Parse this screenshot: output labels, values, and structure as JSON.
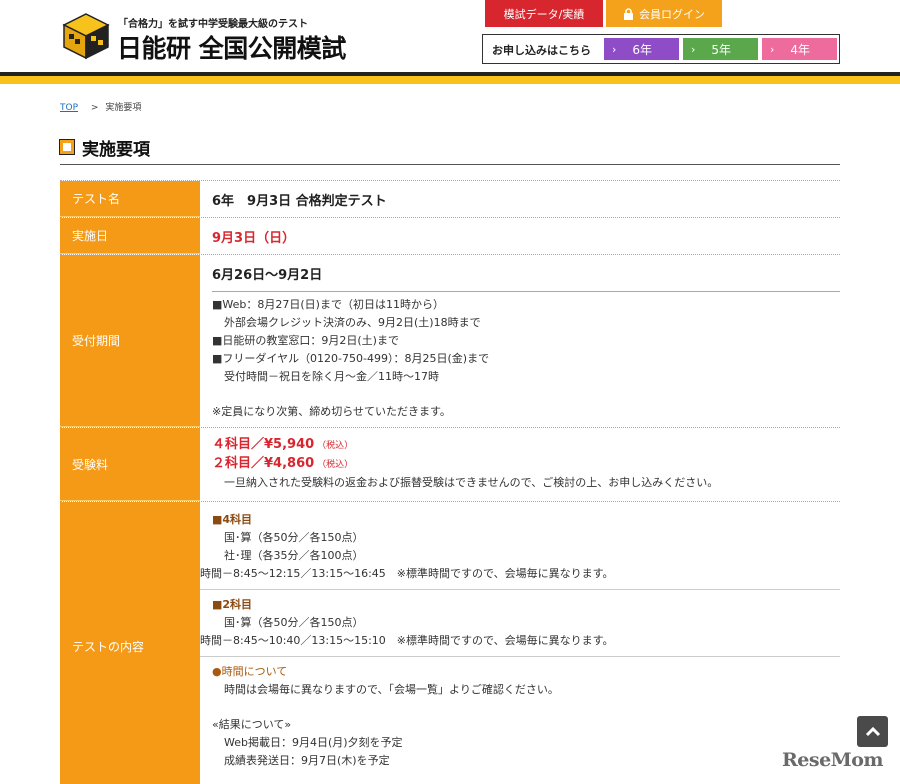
{
  "header": {
    "logo_icon": "nichinoken-zenkoku-logo-cube",
    "tagline": "「合格力」を試す中学受験最大級のテスト",
    "title": "日能研 全国公開模試",
    "data_button": "模試データ/実績",
    "login_button": "会員ログイン",
    "apply_label": "お申し込みはこちら",
    "grade_buttons": [
      {
        "label": "6年",
        "color": "#8e4cc6"
      },
      {
        "label": "5年",
        "color": "#5aa84b"
      },
      {
        "label": "4年",
        "color": "#ee6b9d"
      }
    ]
  },
  "breadcrumb": {
    "top_link": "TOP",
    "separator": ">",
    "current": "実施要項"
  },
  "page_title": "実施要項",
  "table": {
    "test_name": {
      "label": "テスト名",
      "value": "6年　9月3日 合格判定テスト"
    },
    "date": {
      "label": "実施日",
      "value": "9月3日（日）"
    },
    "reception": {
      "label": "受付期間",
      "period": "6月26日～9月2日",
      "lines": [
        "■Web：8月27日(日)まで（初日は11時から）",
        "外部会場クレジット決済のみ、9月2日(土)18時まで",
        "■日能研の教室窓口：9月2日(土)まで",
        "■フリーダイヤル（0120-750-499）：8月25日(金)まで",
        "受付時間－祝日を除く月～金／11時～17時"
      ],
      "note": "※定員になり次第、締め切らせていただきます。"
    },
    "fee": {
      "label": "受験料",
      "fee4": "４科目／¥5,940",
      "fee2": "２科目／¥4,860",
      "tax": "（税込）",
      "note": "一旦納入された受験料の返金および振替受験はできませんので、ご検討の上、お申し込みください。"
    },
    "content": {
      "label": "テストの内容",
      "four_head": "■4科目",
      "four_lines": [
        "国･算（各50分／各150点）",
        "社･理（各35分／各100点）"
      ],
      "four_time": "時間－8:45～12:15／13:15～16:45　※標準時間ですので、会場毎に異なります。",
      "two_head": "■2科目",
      "two_lines": [
        "国･算（各50分／各150点）"
      ],
      "two_time": "時間－8:45～10:40／13:15～15:10　※標準時間ですので、会場毎に異なります。",
      "time_head": "●時間について",
      "time_note": "時間は会場毎に異なりますので、「会場一覧」よりご確認ください。",
      "result_head": "«結果について»",
      "result_lines": [
        "Web掲載日：9月4日(月)夕刻を予定",
        "成績表発送日：9月7日(木)を予定"
      ]
    }
  },
  "scroll_top_icon": "chevron-up-icon",
  "watermark": "ReseMom"
}
